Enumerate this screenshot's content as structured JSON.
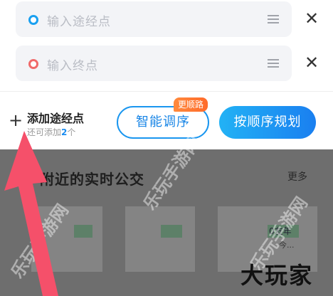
{
  "route": {
    "waypoint_placeholder": "输入途经点",
    "end_placeholder": "输入终点"
  },
  "actions": {
    "add_waypoint": "添加途经点",
    "add_hint_prefix": "还可添加",
    "add_hint_count": "2",
    "add_hint_suffix": "个",
    "smart_order": "智能调序",
    "smart_badge": "更顺路",
    "plan_in_order": "按顺序规划"
  },
  "nearby": {
    "title": "附近的实时公交",
    "more": "更多",
    "route_chip": "0友年",
    "route_hint": "今..."
  },
  "watermarks": {
    "text": "乐玩手游网",
    "logo": "大玩家"
  },
  "colors": {
    "accent": "#1a86e6",
    "badge": "#ff7a33"
  }
}
